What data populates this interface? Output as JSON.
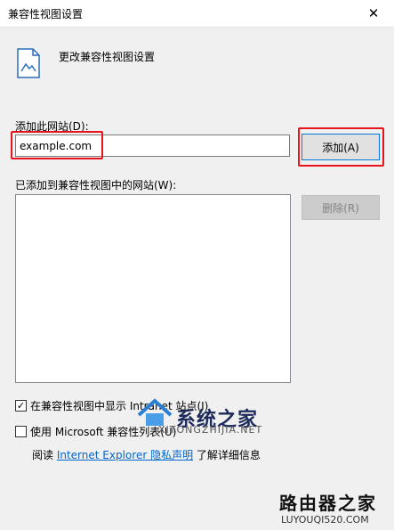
{
  "window": {
    "title": "兼容性视图设置",
    "close_glyph": "✕"
  },
  "header": {
    "label": "更改兼容性视图设置",
    "icon": "document-icon"
  },
  "add_site": {
    "label": "添加此网站(D):",
    "value": "example.com",
    "button_label": "添加(A)"
  },
  "site_list": {
    "label": "已添加到兼容性视图中的网站(W):",
    "remove_label": "删除(R)"
  },
  "options": {
    "intranet_label": "在兼容性视图中显示 Intranet 站点(I)",
    "intranet_checked": true,
    "microsoft_label": "使用 Microsoft 兼容性列表(U)",
    "microsoft_checked": false
  },
  "privacy": {
    "prefix": "阅读 ",
    "link_text": "Internet Explorer 隐私声明",
    "suffix": "了解详细信息"
  },
  "watermarks": {
    "center_big": "系统之家",
    "center_small": "XITONGZHIJIA.NET",
    "corner_big": "路由器之家",
    "corner_small": "LUYOUQI520.COM"
  },
  "colors": {
    "highlight": "#e8141b",
    "link": "#0066cc",
    "focus_border": "#0078d7"
  }
}
